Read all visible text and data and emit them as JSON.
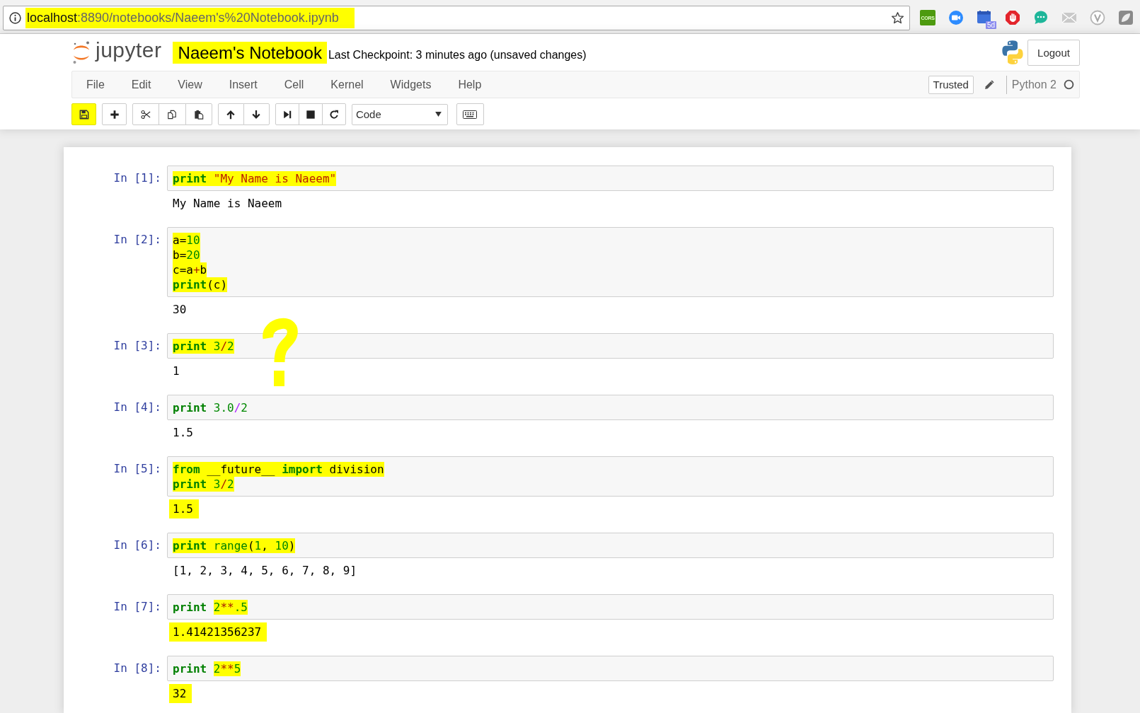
{
  "browser": {
    "url": {
      "host": "localhost",
      "path": ":8890/notebooks/Naeem's%20Notebook.ipynb",
      "highlighted": true
    },
    "extensions": [
      {
        "kind": "cors",
        "label": "CORS"
      },
      {
        "kind": "video"
      },
      {
        "kind": "calendar",
        "badge": "5d"
      },
      {
        "kind": "stop-hand"
      },
      {
        "kind": "chat"
      },
      {
        "kind": "mail"
      },
      {
        "kind": "v-circle"
      },
      {
        "kind": "leaf"
      }
    ]
  },
  "header": {
    "logo_text": "jupyter",
    "notebook_title": {
      "text": "Naeem's Notebook",
      "highlighted": true
    },
    "checkpoint": "Last Checkpoint: 3 minutes ago (unsaved changes)",
    "logout": "Logout"
  },
  "menubar": {
    "items": [
      "File",
      "Edit",
      "View",
      "Insert",
      "Cell",
      "Kernel",
      "Widgets",
      "Help"
    ],
    "trusted": "Trusted",
    "kernel": {
      "name": "Python 2",
      "busy": false
    }
  },
  "toolbar": {
    "items": [
      {
        "kind": "group",
        "buttons": [
          {
            "kind": "save",
            "highlighted": true
          }
        ]
      },
      {
        "kind": "group",
        "buttons": [
          {
            "kind": "insert",
            "highlighted": false
          }
        ]
      },
      {
        "kind": "group",
        "buttons": [
          {
            "kind": "cut",
            "highlighted": false
          },
          {
            "kind": "copy",
            "highlighted": false
          },
          {
            "kind": "paste",
            "highlighted": false
          }
        ]
      },
      {
        "kind": "group",
        "buttons": [
          {
            "kind": "move-up",
            "highlighted": false
          },
          {
            "kind": "move-down",
            "highlighted": false
          }
        ]
      },
      {
        "kind": "group",
        "buttons": [
          {
            "kind": "run",
            "highlighted": false
          },
          {
            "kind": "interrupt",
            "highlighted": false
          },
          {
            "kind": "restart",
            "highlighted": false
          }
        ]
      },
      {
        "kind": "select",
        "value": "Code"
      },
      {
        "kind": "group",
        "buttons": [
          {
            "kind": "keyboard",
            "highlighted": false
          }
        ]
      }
    ]
  },
  "cells": [
    {
      "prompt": "In [1]:",
      "scribble": false,
      "lines": [
        [
          {
            "kind": "keyword",
            "text": "print ",
            "highlighted": true
          },
          {
            "kind": "string",
            "text": "\"My Name is Naeem\"",
            "highlighted": true
          }
        ]
      ],
      "output": {
        "text": "My Name is Naeem",
        "highlighted": false
      }
    },
    {
      "prompt": "In [2]:",
      "scribble": false,
      "lines": [
        [
          {
            "kind": "plain",
            "text": "a=",
            "highlighted": true
          },
          {
            "kind": "number",
            "text": "10",
            "highlighted": true
          }
        ],
        [
          {
            "kind": "plain",
            "text": "b=",
            "highlighted": true
          },
          {
            "kind": "number",
            "text": "20",
            "highlighted": true
          }
        ],
        [
          {
            "kind": "plain",
            "text": "c=a",
            "highlighted": true
          },
          {
            "kind": "operator",
            "text": "+",
            "highlighted": true
          },
          {
            "kind": "plain",
            "text": "b",
            "highlighted": true
          }
        ],
        [
          {
            "kind": "keyword",
            "text": "print",
            "highlighted": true
          },
          {
            "kind": "plain",
            "text": "(c)",
            "highlighted": true
          }
        ]
      ],
      "output": {
        "text": "30",
        "highlighted": false
      }
    },
    {
      "prompt": "In [3]:",
      "scribble": true,
      "lines": [
        [
          {
            "kind": "keyword",
            "text": "print ",
            "highlighted": true
          },
          {
            "kind": "number",
            "text": "3",
            "highlighted": true
          },
          {
            "kind": "operator",
            "text": "/",
            "highlighted": true
          },
          {
            "kind": "number",
            "text": "2",
            "highlighted": true
          }
        ]
      ],
      "output": {
        "text": "1",
        "highlighted": false
      }
    },
    {
      "prompt": "In [4]:",
      "scribble": false,
      "lines": [
        [
          {
            "kind": "keyword",
            "text": "print ",
            "highlighted": false
          },
          {
            "kind": "number",
            "text": "3.0",
            "highlighted": false
          },
          {
            "kind": "operator",
            "text": "/",
            "highlighted": false
          },
          {
            "kind": "number",
            "text": "2",
            "highlighted": false
          }
        ]
      ],
      "output": {
        "text": "1.5",
        "highlighted": false
      }
    },
    {
      "prompt": "In [5]:",
      "scribble": false,
      "lines": [
        [
          {
            "kind": "keyword",
            "text": "from",
            "highlighted": true
          },
          {
            "kind": "plain",
            "text": " __future__ ",
            "highlighted": true
          },
          {
            "kind": "keyword",
            "text": "import",
            "highlighted": true
          },
          {
            "kind": "plain",
            "text": " division",
            "highlighted": true
          }
        ],
        [
          {
            "kind": "keyword",
            "text": "print ",
            "highlighted": true
          },
          {
            "kind": "number",
            "text": "3",
            "highlighted": true
          },
          {
            "kind": "operator",
            "text": "/",
            "highlighted": true
          },
          {
            "kind": "number",
            "text": "2",
            "highlighted": true
          }
        ]
      ],
      "output": {
        "text": "1.5",
        "highlighted": true
      }
    },
    {
      "prompt": "In [6]:",
      "scribble": false,
      "lines": [
        [
          {
            "kind": "keyword",
            "text": "print ",
            "highlighted": true
          },
          {
            "kind": "builtin",
            "text": "range",
            "highlighted": true
          },
          {
            "kind": "plain",
            "text": "(",
            "highlighted": true
          },
          {
            "kind": "number",
            "text": "1",
            "highlighted": true
          },
          {
            "kind": "plain",
            "text": ", ",
            "highlighted": true
          },
          {
            "kind": "number",
            "text": "10",
            "highlighted": true
          },
          {
            "kind": "plain",
            "text": ")",
            "highlighted": true
          }
        ]
      ],
      "output": {
        "text": "[1, 2, 3, 4, 5, 6, 7, 8, 9]",
        "highlighted": false
      }
    },
    {
      "prompt": "In [7]:",
      "scribble": false,
      "lines": [
        [
          {
            "kind": "keyword",
            "text": "print ",
            "highlighted": false
          },
          {
            "kind": "number",
            "text": "2",
            "highlighted": true
          },
          {
            "kind": "operator",
            "text": "**",
            "highlighted": true
          },
          {
            "kind": "number",
            "text": ".5",
            "highlighted": true
          }
        ]
      ],
      "output": {
        "text": "1.41421356237",
        "highlighted": true
      }
    },
    {
      "prompt": "In [8]:",
      "scribble": false,
      "lines": [
        [
          {
            "kind": "keyword",
            "text": "print ",
            "highlighted": false
          },
          {
            "kind": "number",
            "text": "2",
            "highlighted": true
          },
          {
            "kind": "operator",
            "text": "**",
            "highlighted": true
          },
          {
            "kind": "number",
            "text": "5",
            "highlighted": true
          }
        ]
      ],
      "output": {
        "text": "32",
        "highlighted": true
      }
    }
  ]
}
